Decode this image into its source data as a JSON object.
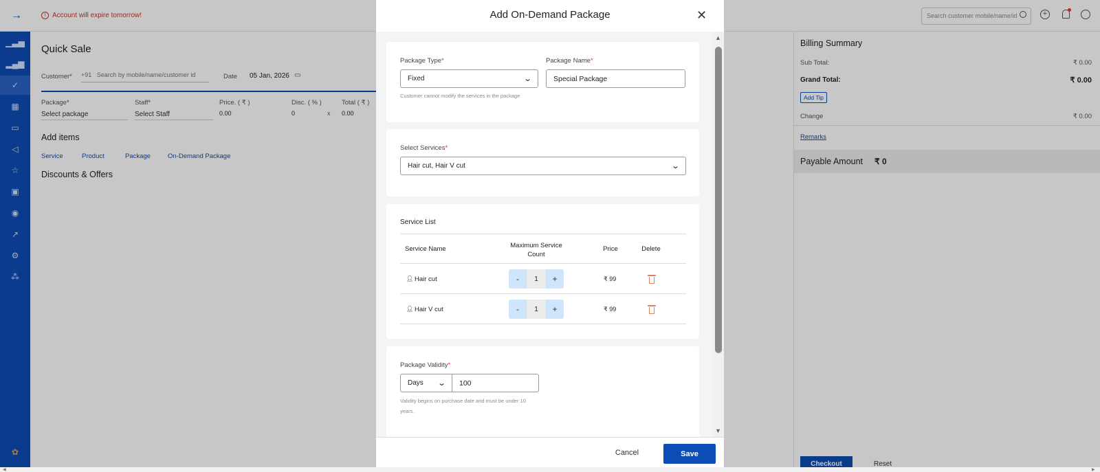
{
  "topbar": {
    "alert": "Account will expire tomorrow!",
    "search_placeholder": "Search customer mobile/name/id"
  },
  "quick_sale": {
    "title": "Quick Sale",
    "customer_label": "Customer*",
    "country_code": "+91",
    "customer_placeholder": "Search by mobile/name/customer id",
    "date_label": "Date",
    "date_value": "05 Jan, 2026",
    "cols": {
      "package": "Package*",
      "staff": "Staff*",
      "price": "Price. ( ₹ )",
      "disc": "Disc. ( % )",
      "total": "Total ( ₹ )"
    },
    "row": {
      "package": "Select package",
      "staff": "Select Staff",
      "price": "0.00",
      "disc": "0",
      "x": "x",
      "total": "0.00"
    },
    "add_items": "Add items",
    "tabs": [
      "Service",
      "Product",
      "Package",
      "On-Demand Package"
    ],
    "discounts": "Discounts & Offers"
  },
  "billing": {
    "title": "Billing Summary",
    "sub_total_label": "Sub Total:",
    "sub_total": "₹ 0.00",
    "grand_total_label": "Grand Total:",
    "grand_total": "₹ 0.00",
    "add_tip": "Add Tip",
    "change_label": "Change",
    "change": "₹ 0.00",
    "remarks": "Remarks",
    "payable_label": "Payable Amount",
    "payable": "₹ 0",
    "checkout": "Checkout",
    "reset": "Reset"
  },
  "modal": {
    "title": "Add On-Demand Package",
    "package_type_label": "Package Type",
    "package_type": "Fixed",
    "package_type_hint": "Customer cannot modify the services in the package",
    "package_name_label": "Package Name",
    "package_name": "Special Package",
    "services_label": "Select Services",
    "services": "Hair cut, Hair V cut",
    "service_list_title": "Service List",
    "columns": {
      "name": "Service Name",
      "max": "Maximum Service Count",
      "price": "Price",
      "delete": "Delete"
    },
    "rows": [
      {
        "name": "Hair cut",
        "count": "1",
        "price": "₹ 99"
      },
      {
        "name": "Hair V cut",
        "count": "1",
        "price": "₹ 99"
      }
    ],
    "stepper": {
      "minus": "-",
      "plus": "+"
    },
    "validity_label": "Package Validity",
    "validity_unit": "Days",
    "validity_value": "100",
    "validity_hint_1": "Validity begins on purchase date and must be under 10",
    "validity_hint_2": "years.",
    "cancel": "Cancel",
    "save": "Save"
  },
  "colors": {
    "brand": "#0d4cb4",
    "alert": "#c0392b",
    "stepper": "#cfe5fb",
    "trash": "#e08060"
  }
}
